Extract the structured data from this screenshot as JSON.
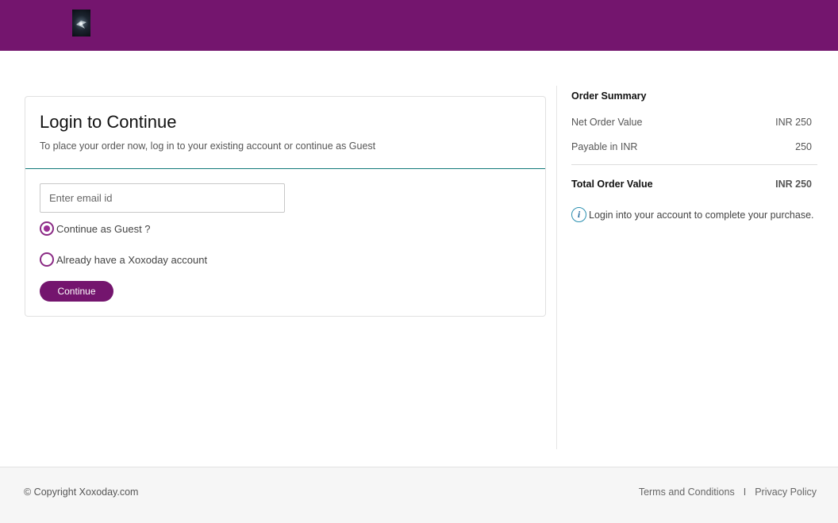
{
  "header": {
    "logo_icon": "brand-logo-icon"
  },
  "login": {
    "title": "Login to Continue",
    "subtitle": "To place your order now, log in to your existing account or continue as Guest",
    "email_placeholder": "Enter email id",
    "email_value": "",
    "options": [
      {
        "label": "Continue as Guest ?",
        "checked": true
      },
      {
        "label": "Already have a Xoxoday account",
        "checked": false
      }
    ],
    "continue_label": "Continue"
  },
  "summary": {
    "title": "Order Summary",
    "rows": [
      {
        "label": "Net Order Value",
        "value": "INR 250"
      },
      {
        "label": "Payable in INR",
        "value": "250"
      }
    ],
    "total": {
      "label": "Total Order Value",
      "value": "INR 250"
    },
    "info_icon": "info-icon",
    "info_text": "Login into your account to complete your purchase."
  },
  "footer": {
    "copyright": "© Copyright Xoxoday.com",
    "terms": "Terms and Conditions",
    "separator": "I",
    "privacy": "Privacy Policy"
  },
  "colors": {
    "brand": "#74156e",
    "radio": "#9b2f95",
    "divider": "#117a7a",
    "info": "#2a8fb0"
  }
}
